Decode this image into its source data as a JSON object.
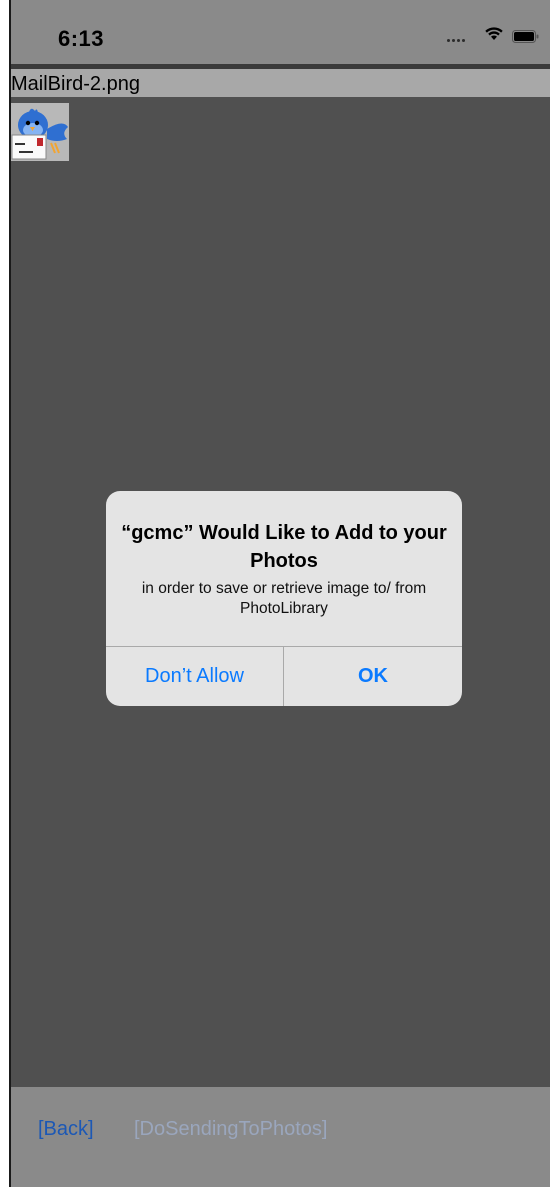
{
  "status_bar": {
    "time": "6:13"
  },
  "file": {
    "name": "MailBird-2.png",
    "thumbnail_icon": "mailbird-icon"
  },
  "dialog": {
    "title": "“gcmc” Would Like to Add to your Photos",
    "message": "in order to save or retrieve image to/ from PhotoLibrary",
    "deny_label": "Don’t Allow",
    "ok_label": "OK",
    "accent_color": "#0a7aff"
  },
  "toolbar": {
    "back_label": "[Back]",
    "send_label": "[DoSendingToPhotos]"
  }
}
